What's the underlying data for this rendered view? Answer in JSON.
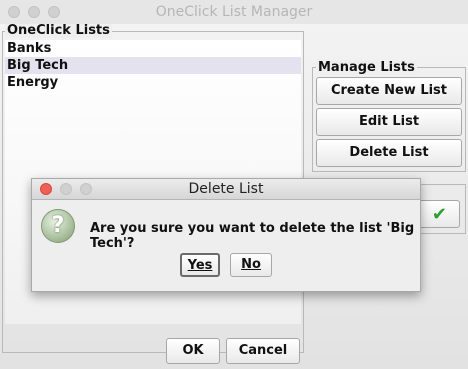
{
  "window": {
    "title": "OneClick List Manager"
  },
  "lists_panel": {
    "legend": "OneClick Lists",
    "items": [
      "Banks",
      "Big Tech",
      "Energy"
    ],
    "selected": "Big Tech"
  },
  "manage_panel": {
    "legend": "Manage Lists",
    "create_label": "Create New List",
    "edit_label": "Edit List",
    "delete_label": "Delete List"
  },
  "footer": {
    "ok_label": "OK",
    "cancel_label": "Cancel"
  },
  "dialog": {
    "title": "Delete List",
    "message": "Are you sure you want to delete the list 'Big Tech'?",
    "yes_label": "Yes",
    "no_label": "No",
    "icon": "question-icon"
  },
  "colors": {
    "selection": "#e3e2ee",
    "close_light": "#ee5f55",
    "check_green": "#2f9e2f"
  }
}
